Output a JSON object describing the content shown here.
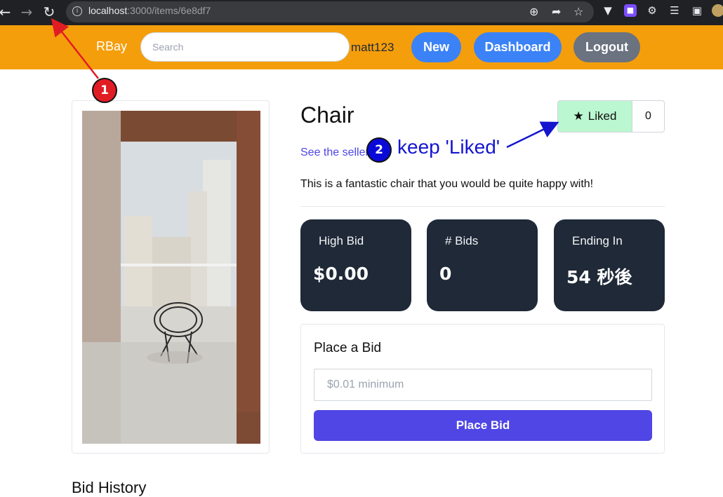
{
  "browser": {
    "url_host": "localhost",
    "url_path": ":3000/items/6e8df7",
    "icons": [
      "back-icon",
      "forward-icon",
      "reload-icon",
      "info-icon",
      "zoom-icon",
      "share-icon",
      "bookmark-star-icon",
      "vue-devtools-icon",
      "ublock-icon",
      "extensions-puzzle-icon",
      "media-icon",
      "sidebar-icon",
      "profile-avatar-icon"
    ]
  },
  "navbar": {
    "brand": "RBay",
    "search_placeholder": "Search",
    "username": "matt123",
    "new_label": "New",
    "dashboard_label": "Dashboard",
    "logout_label": "Logout",
    "background_color": "#f59e0b"
  },
  "item": {
    "title": "Chair",
    "seller_link": "See the seller",
    "description": "This is a fantastic chair that you would be quite happy with!",
    "like_label": "Liked",
    "like_count": "0",
    "stats": [
      {
        "label": "High Bid",
        "value": "$0.00"
      },
      {
        "label": "# Bids",
        "value": "0"
      },
      {
        "label": "Ending In",
        "value": "54 秒後"
      }
    ]
  },
  "bid": {
    "heading": "Place a Bid",
    "input_placeholder": "$0.01 minimum",
    "button_label": "Place Bid",
    "button_color": "#4f46e5"
  },
  "history": {
    "title": "Bid History"
  },
  "annotations": {
    "badge1": "1",
    "badge2": "2",
    "note2": "keep 'Liked'"
  }
}
